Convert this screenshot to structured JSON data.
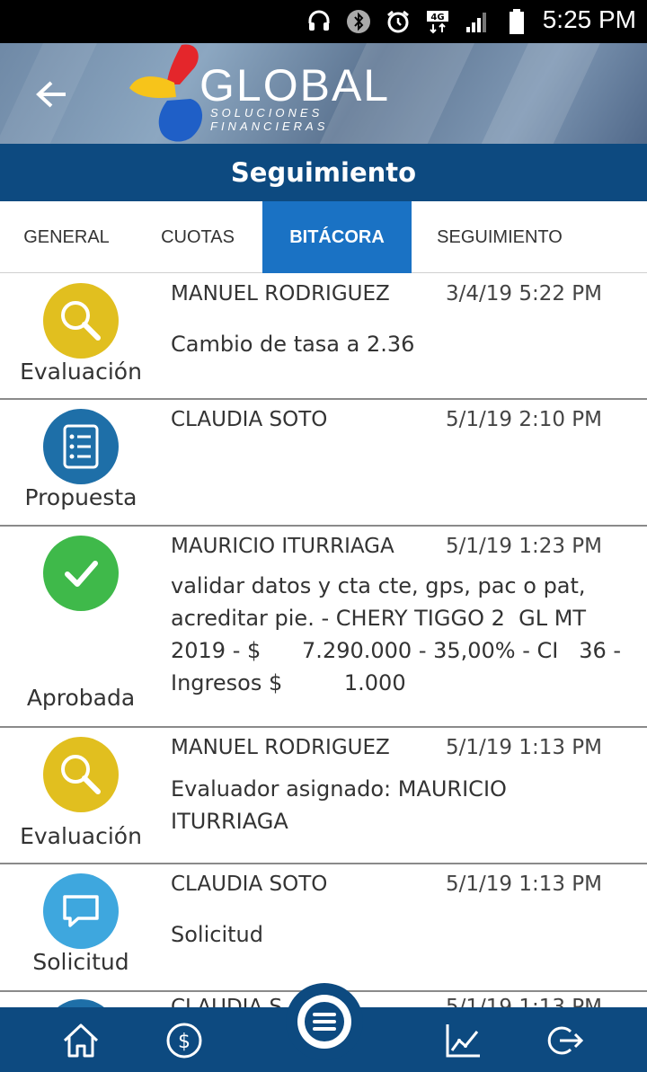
{
  "status_bar": {
    "time": "5:25 PM",
    "icons": [
      "headset-icon",
      "bluetooth-icon",
      "alarm-icon",
      "4g-signal-icon",
      "signal-icon",
      "battery-icon"
    ]
  },
  "header": {
    "logo_word": "GLOBAL",
    "logo_sub": "SOLUCIONES FINANCIERAS",
    "title": "Seguimiento"
  },
  "tabs": [
    {
      "label": "GENERAL",
      "active": false
    },
    {
      "label": "CUOTAS",
      "active": false
    },
    {
      "label": "BITÁCORA",
      "active": true
    },
    {
      "label": "SEGUIMIENTO",
      "active": false
    }
  ],
  "colors": {
    "primary_dark": "#0d4a80",
    "tab_active": "#1a72c4",
    "evaluacion": "#e1bf1f",
    "propuesta": "#1e6fa8",
    "aprobada": "#3fb94a",
    "solicitud": "#3ea7de"
  },
  "entries": [
    {
      "status": "Evaluación",
      "icon": "magnifier-icon",
      "name": "MANUEL RODRIGUEZ",
      "date": "3/4/19 5:22 PM",
      "description": "Cambio de tasa a  2.36"
    },
    {
      "status": "Propuesta",
      "icon": "checklist-icon",
      "name": "CLAUDIA SOTO",
      "date": "5/1/19 2:10 PM",
      "description": ""
    },
    {
      "status": "Aprobada",
      "icon": "checkmark-icon",
      "name": "MAURICIO ITURRIAGA",
      "date": "5/1/19 1:23 PM",
      "description": "validar datos y cta cte, gps, pac o pat, acreditar pie. - CHERY TIGGO 2  GL MT 2019 - $      7.290.000 - 35,00% - CI   36 - Ingresos $         1.000"
    },
    {
      "status": "Evaluación",
      "icon": "magnifier-icon",
      "name": "MANUEL RODRIGUEZ",
      "date": "5/1/19 1:13 PM",
      "description": "Evaluador asignado: MAURICIO ITURRIAGA"
    },
    {
      "status": "Solicitud",
      "icon": "chat-bubble-icon",
      "name": "CLAUDIA SOTO",
      "date": "5/1/19 1:13 PM",
      "description": "Solicitud"
    },
    {
      "status": "",
      "icon": "",
      "name": "CLAUDIA S",
      "date": "5/1/19 1:13 PM",
      "description": ""
    }
  ],
  "bottom_nav": [
    "home-icon",
    "dollar-icon",
    "menu-icon",
    "chart-icon",
    "logout-icon"
  ]
}
